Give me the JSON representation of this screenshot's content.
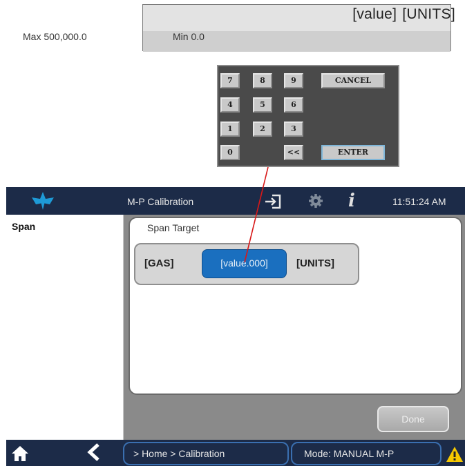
{
  "value_display": {
    "value_label": "[value]",
    "units_label": "[UNITS]",
    "max_text": "Max  500,000.0",
    "min_text": "Min  0.0"
  },
  "keypad": {
    "keys": {
      "k7": "7",
      "k8": "8",
      "k9": "9",
      "k4": "4",
      "k5": "5",
      "k6": "6",
      "k1": "1",
      "k2": "2",
      "k3": "3",
      "k0": "0",
      "backspace": "<<"
    },
    "cancel": "CANCEL",
    "enter": "ENTER"
  },
  "titlebar": {
    "title": "M-P Calibration",
    "time": "11:51:24 AM",
    "info_glyph": "i",
    "icons": [
      "logo-icon",
      "sign-in-icon",
      "gear-icon",
      "info-icon"
    ]
  },
  "sidebar": {
    "items": [
      {
        "label": "Span"
      }
    ]
  },
  "panel": {
    "title": "Span Target",
    "gas_label": "[GAS]",
    "value": "[value.000]",
    "units": "[UNITS]"
  },
  "done_label": "Done",
  "statusbar": {
    "breadcrumb": "> Home > Calibration",
    "mode": "Mode: MANUAL M-P",
    "icons": [
      "home-icon",
      "back-icon",
      "warning-icon"
    ]
  },
  "colors": {
    "titlebar": "#1c2b48",
    "accent_field": "#1a6fbf",
    "connector": "#d81818",
    "warning": "#f5c800"
  }
}
